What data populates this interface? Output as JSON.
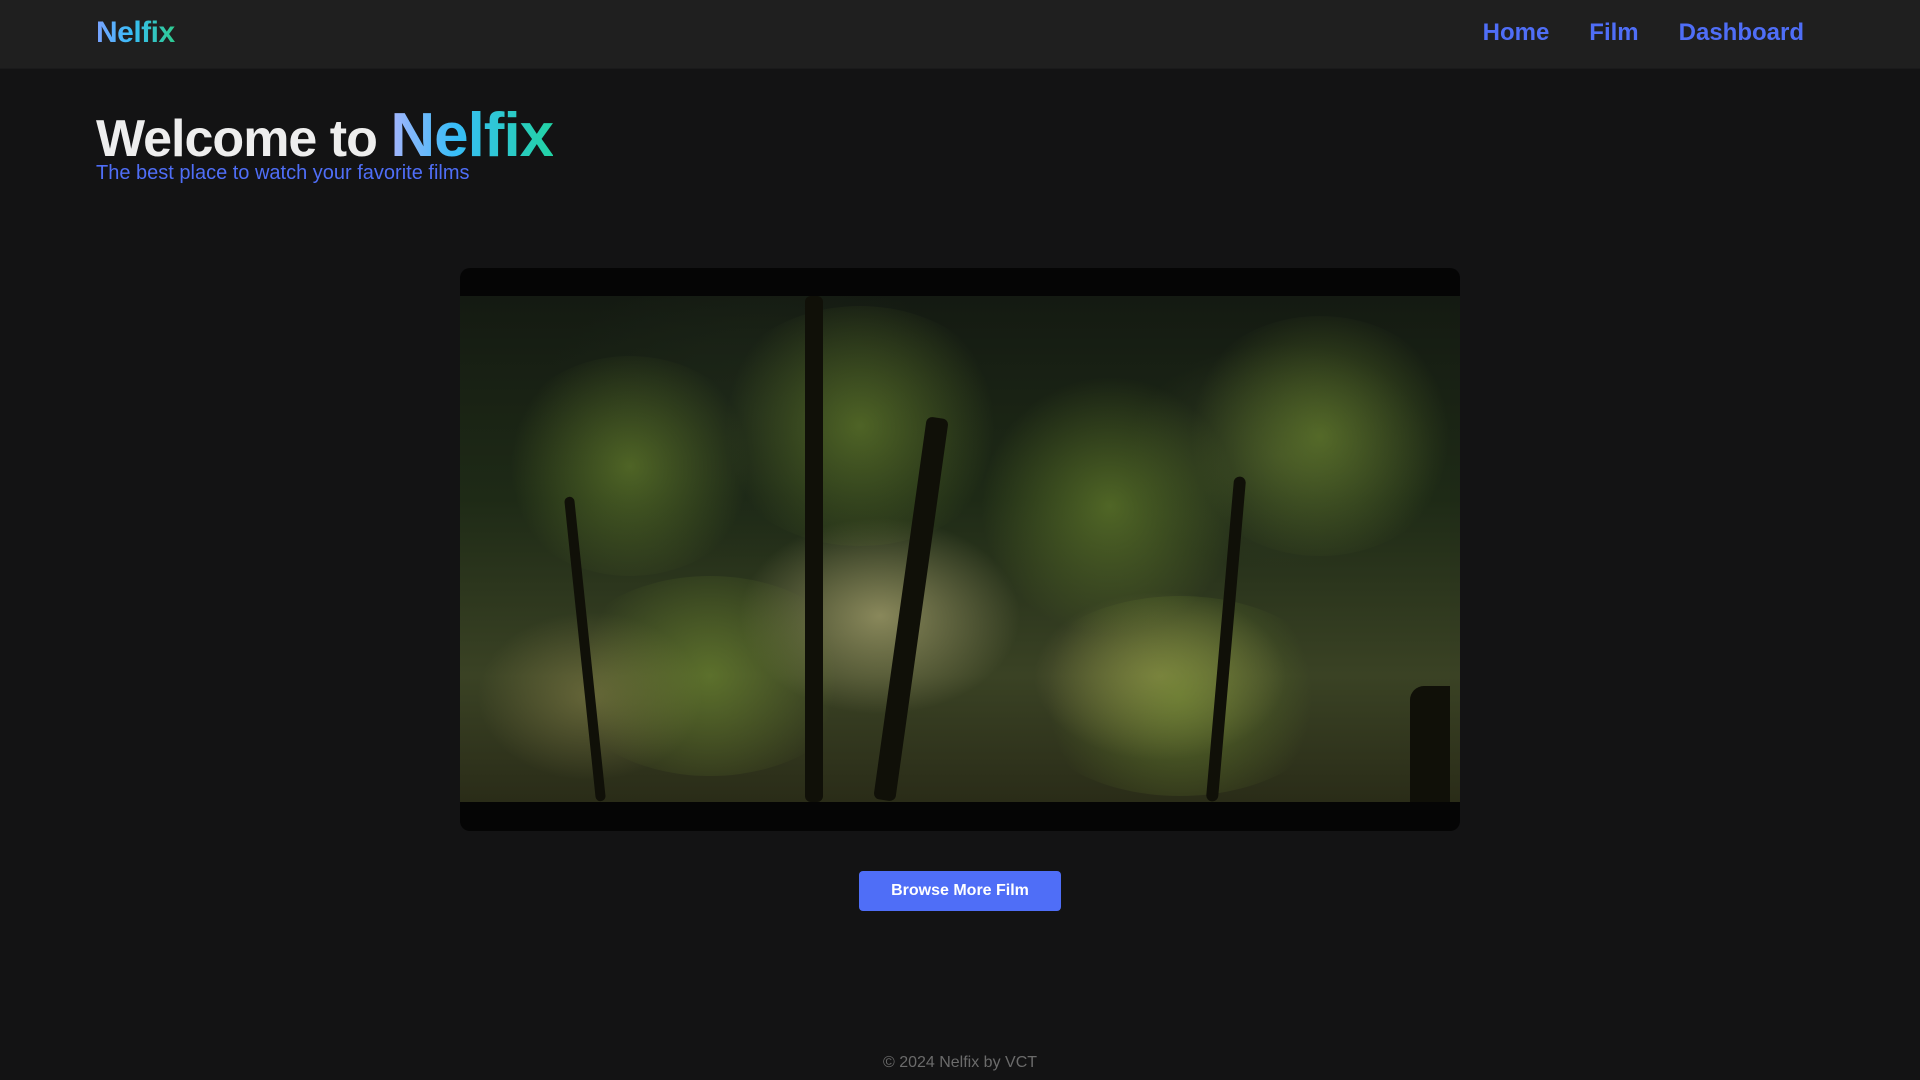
{
  "header": {
    "brand": "Nelfix",
    "nav": [
      {
        "label": "Home"
      },
      {
        "label": "Film"
      },
      {
        "label": "Dashboard"
      }
    ]
  },
  "hero": {
    "title_prefix": "Welcome to ",
    "title_brand": "Nelfix",
    "subtitle": "The best place to watch your favorite films"
  },
  "player": {
    "scene": "forest-trees-sunlight"
  },
  "actions": {
    "browse_label": "Browse More Film"
  },
  "footer": {
    "copyright": "© 2024 Nelfix by VCT"
  },
  "colors": {
    "background": "#131314",
    "topbar": "#1f1f1f",
    "accent": "#4f6ef7",
    "brand_gradient_start": "#7aa2ff",
    "brand_gradient_end": "#2ecc8f"
  }
}
